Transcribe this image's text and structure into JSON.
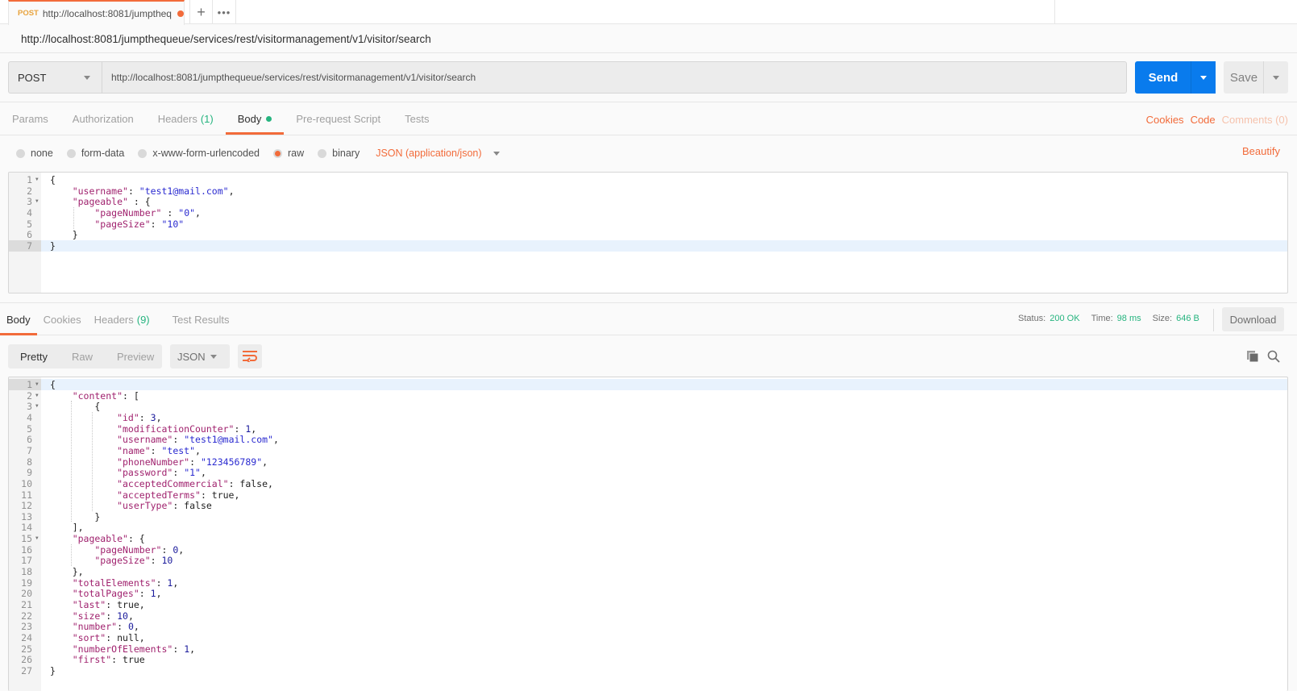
{
  "tabbar": {
    "tab": {
      "method": "POST",
      "title": "http://localhost:8081/jumptheq",
      "unsaved": true
    },
    "new_tab_label": "+",
    "more_label": "•••"
  },
  "request": {
    "name": "http://localhost:8081/jumpthequeue/services/rest/visitormanagement/v1/visitor/search",
    "method": "POST",
    "url": "http://localhost:8081/jumpthequeue/services/rest/visitormanagement/v1/visitor/search",
    "send_label": "Send",
    "save_label": "Save",
    "tabs": [
      {
        "label": "Params"
      },
      {
        "label": "Authorization"
      },
      {
        "label": "Headers",
        "count": "(1)"
      },
      {
        "label": "Body",
        "active": true,
        "indicator": "green-dot"
      },
      {
        "label": "Pre-request Script"
      },
      {
        "label": "Tests"
      }
    ],
    "links": {
      "cookies": "Cookies",
      "code": "Code",
      "comments": "Comments (0)"
    },
    "body_types": [
      {
        "label": "none",
        "selected": false
      },
      {
        "label": "form-data",
        "selected": false
      },
      {
        "label": "x-www-form-urlencoded",
        "selected": false
      },
      {
        "label": "raw",
        "selected": true
      },
      {
        "label": "binary",
        "selected": false
      }
    ],
    "content_type": "JSON (application/json)",
    "beautify_label": "Beautify",
    "body_lines": [
      [
        [
          "p",
          "{"
        ]
      ],
      [
        [
          "k",
          "    \"username\""
        ],
        [
          "p",
          ": "
        ],
        [
          "s",
          "\"test1@mail.com\""
        ],
        [
          "p",
          ","
        ]
      ],
      [
        [
          "k",
          "    \"pageable\""
        ],
        [
          "p",
          " : {"
        ]
      ],
      [
        [
          "k",
          "        \"pageNumber\""
        ],
        [
          "p",
          " : "
        ],
        [
          "s",
          "\"0\""
        ],
        [
          "p",
          ","
        ]
      ],
      [
        [
          "k",
          "        \"pageSize\""
        ],
        [
          "p",
          ": "
        ],
        [
          "s",
          "\"10\""
        ]
      ],
      [
        [
          "p",
          "    }"
        ]
      ],
      [
        [
          "p",
          "}"
        ]
      ]
    ],
    "body_folds": [
      1,
      3
    ]
  },
  "response": {
    "tabs": [
      {
        "label": "Body",
        "active": true
      },
      {
        "label": "Cookies"
      },
      {
        "label": "Headers",
        "count": "(9)"
      },
      {
        "label": "Test Results"
      }
    ],
    "status_label": "Status:",
    "status": "200 OK",
    "time_label": "Time:",
    "time": "98 ms",
    "size_label": "Size:",
    "size": "646 B",
    "download_label": "Download",
    "views": [
      {
        "label": "Pretty",
        "active": true
      },
      {
        "label": "Raw"
      },
      {
        "label": "Preview"
      }
    ],
    "format": "JSON",
    "body_lines": [
      [
        [
          "p",
          "{"
        ]
      ],
      [
        [
          "k",
          "    \"content\""
        ],
        [
          "p",
          ": ["
        ]
      ],
      [
        [
          "p",
          "        {"
        ]
      ],
      [
        [
          "k",
          "            \"id\""
        ],
        [
          "p",
          ": "
        ],
        [
          "n",
          "3"
        ],
        [
          "p",
          ","
        ]
      ],
      [
        [
          "k",
          "            \"modificationCounter\""
        ],
        [
          "p",
          ": "
        ],
        [
          "n",
          "1"
        ],
        [
          "p",
          ","
        ]
      ],
      [
        [
          "k",
          "            \"username\""
        ],
        [
          "p",
          ": "
        ],
        [
          "s",
          "\"test1@mail.com\""
        ],
        [
          "p",
          ","
        ]
      ],
      [
        [
          "k",
          "            \"name\""
        ],
        [
          "p",
          ": "
        ],
        [
          "s",
          "\"test\""
        ],
        [
          "p",
          ","
        ]
      ],
      [
        [
          "k",
          "            \"phoneNumber\""
        ],
        [
          "p",
          ": "
        ],
        [
          "s",
          "\"123456789\""
        ],
        [
          "p",
          ","
        ]
      ],
      [
        [
          "k",
          "            \"password\""
        ],
        [
          "p",
          ": "
        ],
        [
          "s",
          "\"1\""
        ],
        [
          "p",
          ","
        ]
      ],
      [
        [
          "k",
          "            \"acceptedCommercial\""
        ],
        [
          "p",
          ": false,"
        ]
      ],
      [
        [
          "k",
          "            \"acceptedTerms\""
        ],
        [
          "p",
          ": true,"
        ]
      ],
      [
        [
          "k",
          "            \"userType\""
        ],
        [
          "p",
          ": false"
        ]
      ],
      [
        [
          "p",
          "        }"
        ]
      ],
      [
        [
          "p",
          "    ],"
        ]
      ],
      [
        [
          "k",
          "    \"pageable\""
        ],
        [
          "p",
          ": {"
        ]
      ],
      [
        [
          "k",
          "        \"pageNumber\""
        ],
        [
          "p",
          ": "
        ],
        [
          "n",
          "0"
        ],
        [
          "p",
          ","
        ]
      ],
      [
        [
          "k",
          "        \"pageSize\""
        ],
        [
          "p",
          ": "
        ],
        [
          "n",
          "10"
        ]
      ],
      [
        [
          "p",
          "    },"
        ]
      ],
      [
        [
          "k",
          "    \"totalElements\""
        ],
        [
          "p",
          ": "
        ],
        [
          "n",
          "1"
        ],
        [
          "p",
          ","
        ]
      ],
      [
        [
          "k",
          "    \"totalPages\""
        ],
        [
          "p",
          ": "
        ],
        [
          "n",
          "1"
        ],
        [
          "p",
          ","
        ]
      ],
      [
        [
          "k",
          "    \"last\""
        ],
        [
          "p",
          ": true,"
        ]
      ],
      [
        [
          "k",
          "    \"size\""
        ],
        [
          "p",
          ": "
        ],
        [
          "n",
          "10"
        ],
        [
          "p",
          ","
        ]
      ],
      [
        [
          "k",
          "    \"number\""
        ],
        [
          "p",
          ": "
        ],
        [
          "n",
          "0"
        ],
        [
          "p",
          ","
        ]
      ],
      [
        [
          "k",
          "    \"sort\""
        ],
        [
          "p",
          ": null,"
        ]
      ],
      [
        [
          "k",
          "    \"numberOfElements\""
        ],
        [
          "p",
          ": "
        ],
        [
          "n",
          "1"
        ],
        [
          "p",
          ","
        ]
      ],
      [
        [
          "k",
          "    \"first\""
        ],
        [
          "p",
          ": true"
        ]
      ],
      [
        [
          "p",
          "}"
        ]
      ]
    ],
    "body_folds": [
      1,
      2,
      3,
      15
    ]
  },
  "colors": {
    "accent": "#f26b3a",
    "send": "#097bed",
    "success": "#26b47f"
  }
}
